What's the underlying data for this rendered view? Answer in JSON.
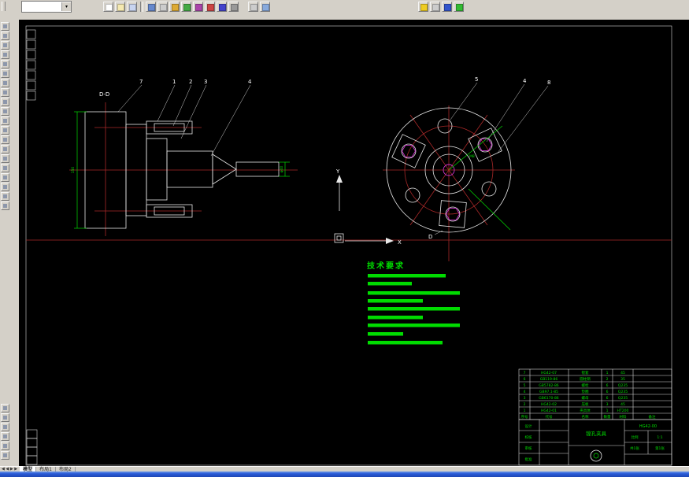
{
  "colors": {
    "green": "#00dc00",
    "red": "#a82828",
    "magenta": "#cc33cc",
    "line": "#e8e8e8"
  },
  "toolbar": {
    "combo_value": ""
  },
  "drawing": {
    "section_label": "D-D",
    "callouts_left": [
      "7",
      "1",
      "2",
      "3",
      "4"
    ],
    "callouts_right": [
      "5",
      "4",
      "8"
    ],
    "ucs": {
      "x_label": "X",
      "y_label": "Y"
    },
    "section_marker": "D",
    "dims": {
      "plate_height": "150",
      "bar_dia": "φ40",
      "thread": "M8"
    }
  },
  "tech": {
    "title": "技术要求",
    "bars": [
      [
        348,
        99
      ],
      [
        358,
        56
      ],
      [
        370,
        117
      ],
      [
        380,
        70
      ],
      [
        390,
        117
      ],
      [
        401,
        70
      ],
      [
        411,
        117
      ],
      [
        422,
        45
      ],
      [
        433,
        95
      ]
    ]
  },
  "parts_table": {
    "header": [
      "序号",
      "代号",
      "名称",
      "数量",
      "材料",
      "备注"
    ],
    "rows": [
      [
        "7",
        "HG42-07",
        "镗套",
        "1",
        "45"
      ],
      [
        "6",
        "GB119-86",
        "圆柱销",
        "2",
        "35"
      ],
      [
        "5",
        "GB5782-86",
        "螺栓",
        "6",
        "Q235"
      ],
      [
        "4",
        "GB97.1-85",
        "垫圈",
        "6",
        "Q235"
      ],
      [
        "3",
        "GB6170-86",
        "螺母",
        "6",
        "Q235"
      ],
      [
        "2",
        "HG42-02",
        "压板",
        "3",
        "45"
      ],
      [
        "1",
        "HG42-01",
        "夹具体",
        "1",
        "HT200"
      ]
    ]
  },
  "title_block": {
    "sign_labels": [
      "设计",
      "校核",
      "审核",
      "批准"
    ],
    "title": "镗孔夹具",
    "drawing_no": "HG42-00",
    "scale_label": "比例",
    "scale": "1:1",
    "sheet_label": "共1张",
    "page_label": "第1张"
  },
  "status": {
    "nav": "◀ ◀ ▶ ▶",
    "tabs": [
      "模型",
      "布局1",
      "布局2"
    ]
  }
}
